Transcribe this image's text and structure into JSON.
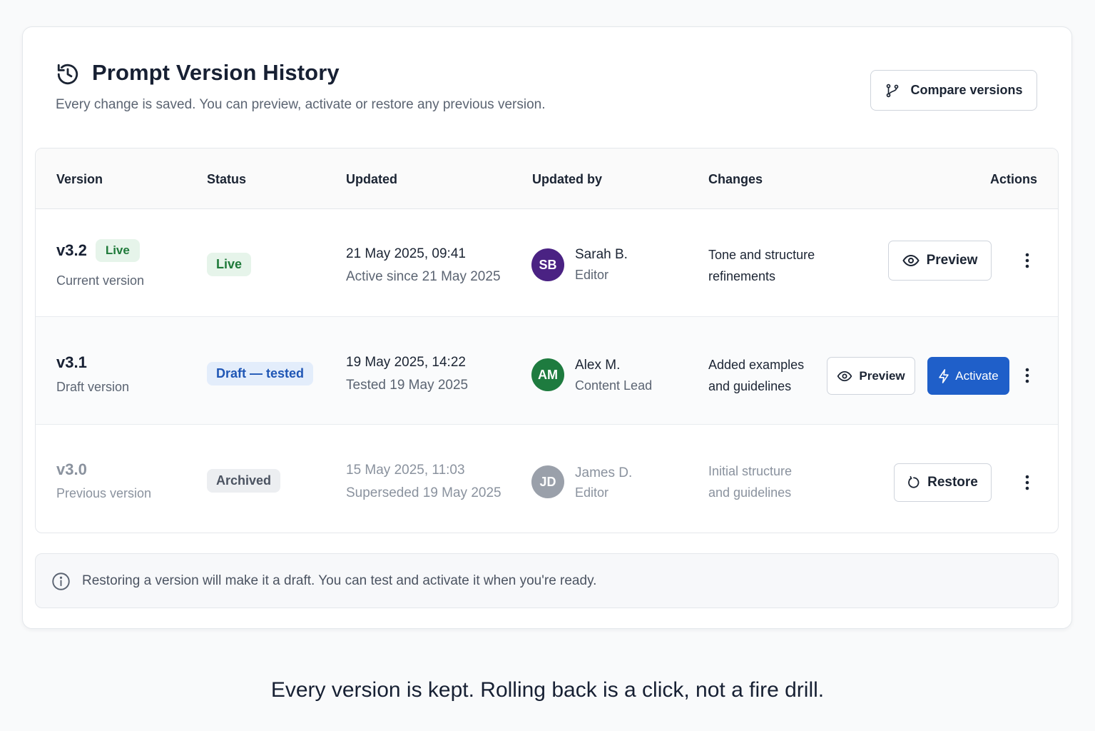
{
  "header": {
    "title": "Prompt Version History",
    "subtitle": "Every change is saved. You can preview, activate or restore any previous version.",
    "compare_label": "Compare versions",
    "history_icon": "history-icon",
    "branch_icon": "git-branch-icon"
  },
  "table": {
    "columns": [
      "Version",
      "Status",
      "Updated",
      "Updated by",
      "Changes",
      "Actions"
    ],
    "rows": [
      {
        "version": "v3.2",
        "version_badge": "Live",
        "version_sub": "Current version",
        "status": "Live",
        "updated": "21 May 2025, 09:41",
        "updated_sub": "Active since 21 May 2025",
        "initials": "SB",
        "name": "Sarah B.",
        "role": "Editor",
        "changes_1": "Tone and structure",
        "changes_2": "refinements",
        "preview_label": "Preview",
        "avatar_color": "#4a2283"
      },
      {
        "version": "v3.1",
        "version_sub": "Draft version",
        "status": "Draft — tested",
        "updated": "19 May 2025, 14:22",
        "updated_sub": "Tested 19 May 2025",
        "initials": "AM",
        "name": "Alex M.",
        "role": "Content Lead",
        "changes_1": "Added examples",
        "changes_2": "and guidelines",
        "preview_label": "Preview",
        "activate_label": "Activate",
        "avatar_color": "#1e7b3f"
      },
      {
        "version": "v3.0",
        "version_sub": "Previous version",
        "status": "Archived",
        "updated": "15 May 2025, 11:03",
        "updated_sub": "Superseded 19 May 2025",
        "initials": "JD",
        "name": "James D.",
        "role": "Editor",
        "changes_1": "Initial structure",
        "changes_2": "and guidelines",
        "restore_label": "Restore",
        "avatar_color": "#9aa0aa"
      }
    ]
  },
  "info": {
    "text": "Restoring a version will make it a draft. You can test and activate it when you're ready.",
    "icon": "info-icon"
  },
  "tagline": "Every version is kept. Rolling back is a click, not a fire drill.",
  "colors": {
    "primary": "#1f5fc9",
    "live_bg": "#e6f4ea",
    "live_text": "#1f7a3a",
    "draft_bg": "#e3edfb",
    "draft_text": "#1f56b5",
    "archived_bg": "#eceef1"
  }
}
